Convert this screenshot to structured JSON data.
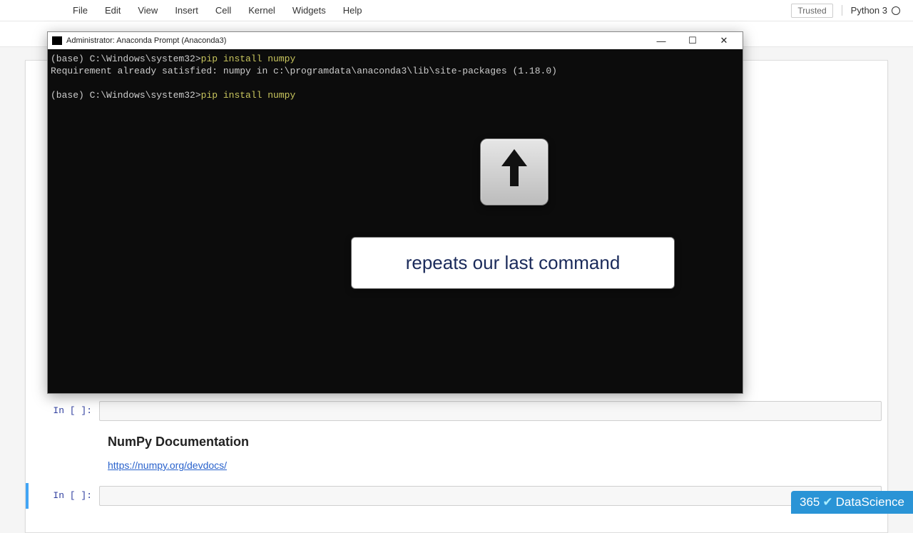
{
  "menubar": {
    "items": [
      "File",
      "Edit",
      "View",
      "Insert",
      "Cell",
      "Kernel",
      "Widgets",
      "Help"
    ],
    "trusted": "Trusted",
    "kernel": "Python 3"
  },
  "notebook": {
    "cells": [
      {
        "prompt": "In [ ]:"
      },
      {
        "prompt": "In [ ]:"
      }
    ],
    "markdown": {
      "heading": "NumPy Documentation",
      "link_text": "https://numpy.org/devdocs/",
      "link_href": "https://numpy.org/devdocs/"
    }
  },
  "terminal": {
    "title": "Administrator: Anaconda Prompt (Anaconda3)",
    "lines": [
      {
        "prompt": "(base) C:\\Windows\\system32>",
        "cmd": "pip install numpy"
      },
      {
        "text": "Requirement already satisfied: numpy in c:\\programdata\\anaconda3\\lib\\site-packages (1.18.0)"
      },
      {
        "blank": true
      },
      {
        "prompt": "(base) C:\\Windows\\system32>",
        "cmd": "pip install numpy"
      }
    ],
    "controls": {
      "min": "—",
      "max": "☐",
      "close": "✕"
    }
  },
  "overlay": {
    "key_symbol": "↑",
    "caption": "repeats our last command"
  },
  "watermark": {
    "brand_left": "365",
    "brand_right": "DataScience"
  }
}
